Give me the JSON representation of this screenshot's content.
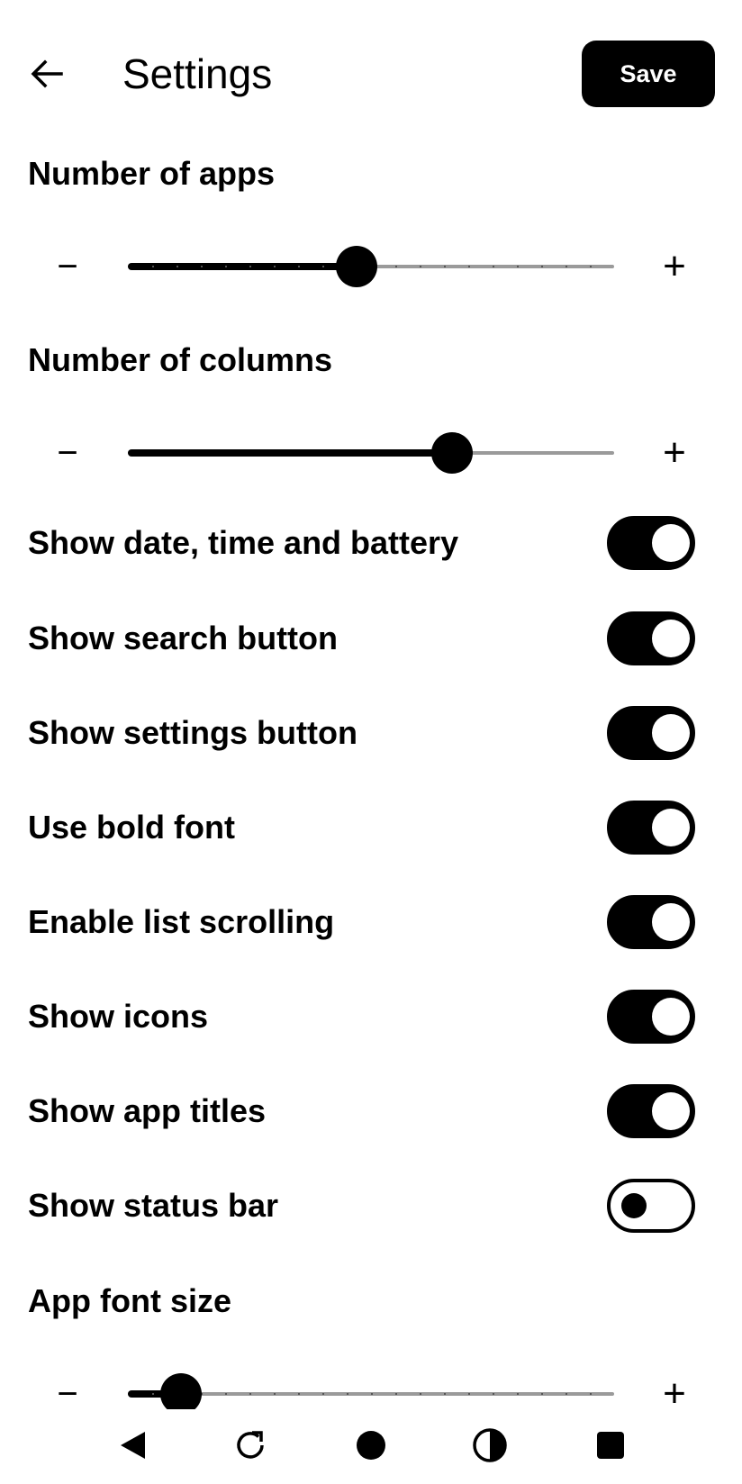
{
  "header": {
    "title": "Settings",
    "save_label": "Save",
    "back_icon": "arrow-left-icon"
  },
  "sliders": {
    "apps": {
      "label": "Number of apps",
      "value_fraction": 0.47,
      "ticks": 20
    },
    "columns": {
      "label": "Number of columns",
      "value_fraction": 0.667,
      "ticks": 0
    },
    "font_size": {
      "label": "App font size",
      "value_fraction": 0.11,
      "ticks": 20
    },
    "minus_symbol": "−",
    "plus_symbol": "+"
  },
  "toggles": [
    {
      "label": "Show date, time and battery",
      "on": true
    },
    {
      "label": "Show search button",
      "on": true
    },
    {
      "label": "Show settings button",
      "on": true
    },
    {
      "label": "Use bold font",
      "on": true
    },
    {
      "label": "Enable list scrolling",
      "on": true
    },
    {
      "label": "Show icons",
      "on": true
    },
    {
      "label": "Show app titles",
      "on": true
    },
    {
      "label": "Show status bar",
      "on": false
    }
  ],
  "navbar": {
    "icons": [
      "triangle-back-icon",
      "refresh-icon",
      "home-circle-icon",
      "contrast-icon",
      "square-recents-icon"
    ]
  }
}
